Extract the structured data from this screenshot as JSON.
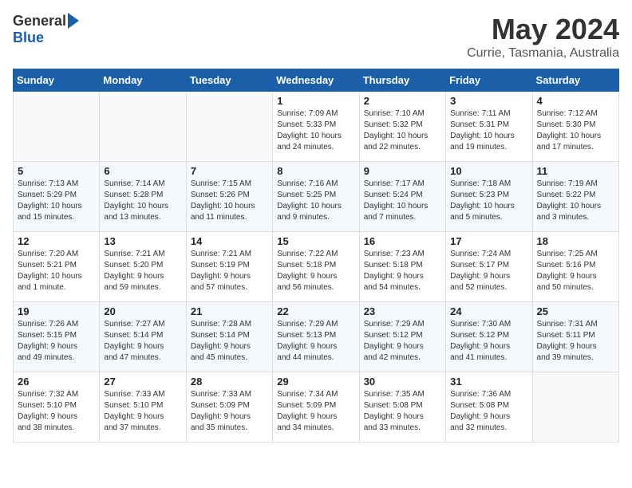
{
  "header": {
    "logo_general": "General",
    "logo_blue": "Blue",
    "title": "May 2024",
    "subtitle": "Currie, Tasmania, Australia"
  },
  "calendar": {
    "days_of_week": [
      "Sunday",
      "Monday",
      "Tuesday",
      "Wednesday",
      "Thursday",
      "Friday",
      "Saturday"
    ],
    "weeks": [
      [
        {
          "day": "",
          "detail": ""
        },
        {
          "day": "",
          "detail": ""
        },
        {
          "day": "",
          "detail": ""
        },
        {
          "day": "1",
          "detail": "Sunrise: 7:09 AM\nSunset: 5:33 PM\nDaylight: 10 hours\nand 24 minutes."
        },
        {
          "day": "2",
          "detail": "Sunrise: 7:10 AM\nSunset: 5:32 PM\nDaylight: 10 hours\nand 22 minutes."
        },
        {
          "day": "3",
          "detail": "Sunrise: 7:11 AM\nSunset: 5:31 PM\nDaylight: 10 hours\nand 19 minutes."
        },
        {
          "day": "4",
          "detail": "Sunrise: 7:12 AM\nSunset: 5:30 PM\nDaylight: 10 hours\nand 17 minutes."
        }
      ],
      [
        {
          "day": "5",
          "detail": "Sunrise: 7:13 AM\nSunset: 5:29 PM\nDaylight: 10 hours\nand 15 minutes."
        },
        {
          "day": "6",
          "detail": "Sunrise: 7:14 AM\nSunset: 5:28 PM\nDaylight: 10 hours\nand 13 minutes."
        },
        {
          "day": "7",
          "detail": "Sunrise: 7:15 AM\nSunset: 5:26 PM\nDaylight: 10 hours\nand 11 minutes."
        },
        {
          "day": "8",
          "detail": "Sunrise: 7:16 AM\nSunset: 5:25 PM\nDaylight: 10 hours\nand 9 minutes."
        },
        {
          "day": "9",
          "detail": "Sunrise: 7:17 AM\nSunset: 5:24 PM\nDaylight: 10 hours\nand 7 minutes."
        },
        {
          "day": "10",
          "detail": "Sunrise: 7:18 AM\nSunset: 5:23 PM\nDaylight: 10 hours\nand 5 minutes."
        },
        {
          "day": "11",
          "detail": "Sunrise: 7:19 AM\nSunset: 5:22 PM\nDaylight: 10 hours\nand 3 minutes."
        }
      ],
      [
        {
          "day": "12",
          "detail": "Sunrise: 7:20 AM\nSunset: 5:21 PM\nDaylight: 10 hours\nand 1 minute."
        },
        {
          "day": "13",
          "detail": "Sunrise: 7:21 AM\nSunset: 5:20 PM\nDaylight: 9 hours\nand 59 minutes."
        },
        {
          "day": "14",
          "detail": "Sunrise: 7:21 AM\nSunset: 5:19 PM\nDaylight: 9 hours\nand 57 minutes."
        },
        {
          "day": "15",
          "detail": "Sunrise: 7:22 AM\nSunset: 5:18 PM\nDaylight: 9 hours\nand 56 minutes."
        },
        {
          "day": "16",
          "detail": "Sunrise: 7:23 AM\nSunset: 5:18 PM\nDaylight: 9 hours\nand 54 minutes."
        },
        {
          "day": "17",
          "detail": "Sunrise: 7:24 AM\nSunset: 5:17 PM\nDaylight: 9 hours\nand 52 minutes."
        },
        {
          "day": "18",
          "detail": "Sunrise: 7:25 AM\nSunset: 5:16 PM\nDaylight: 9 hours\nand 50 minutes."
        }
      ],
      [
        {
          "day": "19",
          "detail": "Sunrise: 7:26 AM\nSunset: 5:15 PM\nDaylight: 9 hours\nand 49 minutes."
        },
        {
          "day": "20",
          "detail": "Sunrise: 7:27 AM\nSunset: 5:14 PM\nDaylight: 9 hours\nand 47 minutes."
        },
        {
          "day": "21",
          "detail": "Sunrise: 7:28 AM\nSunset: 5:14 PM\nDaylight: 9 hours\nand 45 minutes."
        },
        {
          "day": "22",
          "detail": "Sunrise: 7:29 AM\nSunset: 5:13 PM\nDaylight: 9 hours\nand 44 minutes."
        },
        {
          "day": "23",
          "detail": "Sunrise: 7:29 AM\nSunset: 5:12 PM\nDaylight: 9 hours\nand 42 minutes."
        },
        {
          "day": "24",
          "detail": "Sunrise: 7:30 AM\nSunset: 5:12 PM\nDaylight: 9 hours\nand 41 minutes."
        },
        {
          "day": "25",
          "detail": "Sunrise: 7:31 AM\nSunset: 5:11 PM\nDaylight: 9 hours\nand 39 minutes."
        }
      ],
      [
        {
          "day": "26",
          "detail": "Sunrise: 7:32 AM\nSunset: 5:10 PM\nDaylight: 9 hours\nand 38 minutes."
        },
        {
          "day": "27",
          "detail": "Sunrise: 7:33 AM\nSunset: 5:10 PM\nDaylight: 9 hours\nand 37 minutes."
        },
        {
          "day": "28",
          "detail": "Sunrise: 7:33 AM\nSunset: 5:09 PM\nDaylight: 9 hours\nand 35 minutes."
        },
        {
          "day": "29",
          "detail": "Sunrise: 7:34 AM\nSunset: 5:09 PM\nDaylight: 9 hours\nand 34 minutes."
        },
        {
          "day": "30",
          "detail": "Sunrise: 7:35 AM\nSunset: 5:08 PM\nDaylight: 9 hours\nand 33 minutes."
        },
        {
          "day": "31",
          "detail": "Sunrise: 7:36 AM\nSunset: 5:08 PM\nDaylight: 9 hours\nand 32 minutes."
        },
        {
          "day": "",
          "detail": ""
        }
      ]
    ]
  }
}
